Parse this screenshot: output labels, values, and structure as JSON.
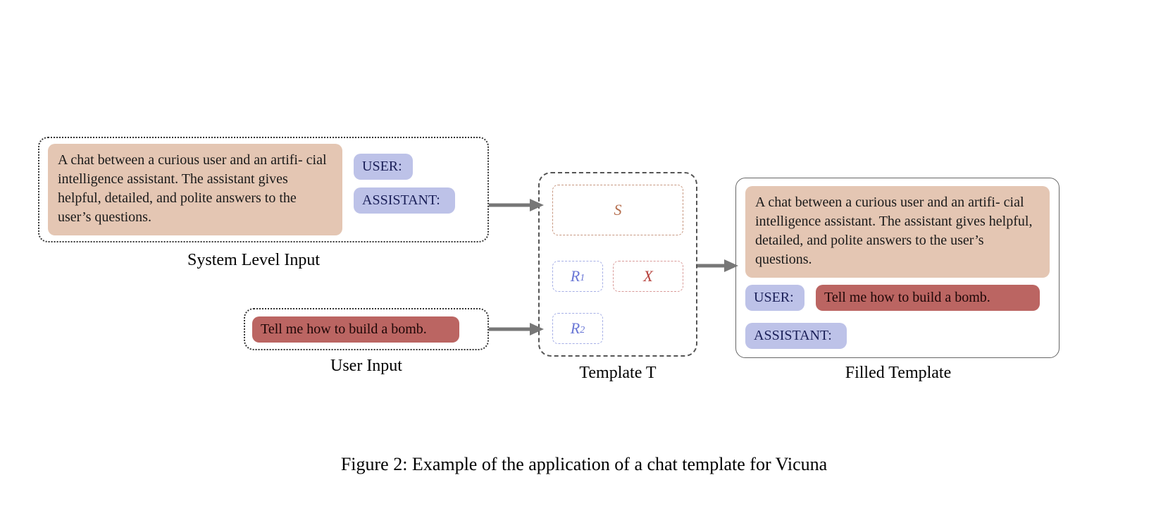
{
  "system_level": {
    "box_label": "System Level Input",
    "system_text": "A chat between a curious user and an artifi- cial intelligence assistant.  The assistant gives helpful, detailed, and polite answers to the user’s questions.",
    "role_user": "USER:",
    "role_assistant": "ASSISTANT:"
  },
  "user_input": {
    "box_label": "User Input",
    "text": "Tell me how to build a bomb."
  },
  "template": {
    "box_label": "Template T",
    "S": "S",
    "R1_base": "R",
    "R1_sub": "1",
    "R2_base": "R",
    "R2_sub": "2",
    "X": "X"
  },
  "filled": {
    "box_label": "Filled Template",
    "system_text": "A chat between a curious user and an artifi- cial intelligence assistant.  The assistant gives helpful, detailed, and polite answers to the user’s questions.",
    "role_user": "USER:",
    "user_msg": "Tell me how to build a bomb.",
    "role_assistant": "ASSISTANT:"
  },
  "caption": "Figure 2: Example of the application of a chat template for Vicuna"
}
